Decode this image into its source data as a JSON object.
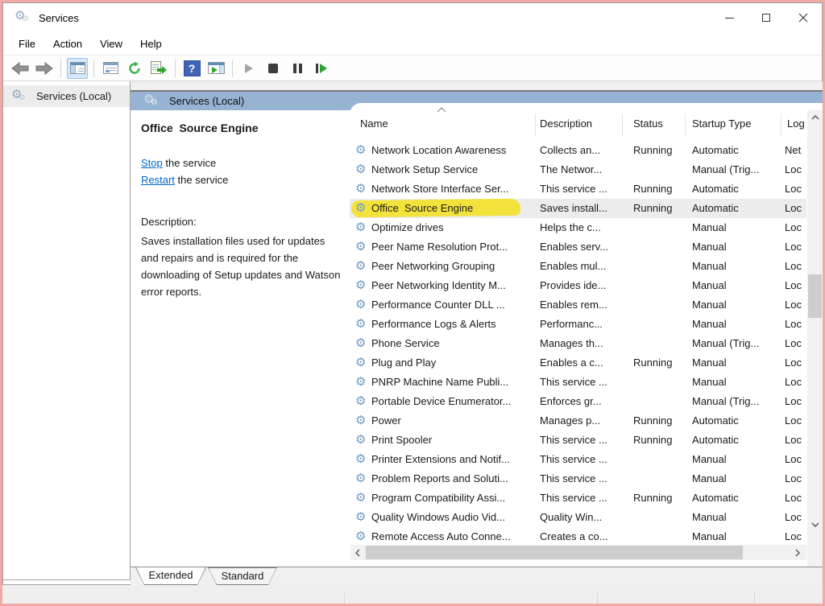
{
  "window": {
    "title": "Services"
  },
  "menu": {
    "items": [
      "File",
      "Action",
      "View",
      "Help"
    ]
  },
  "toolbar": {
    "icons": [
      "back",
      "forward",
      "show-console-tree",
      "properties",
      "refresh",
      "export-list",
      "help",
      "show-action-pane",
      "start-service",
      "stop-service",
      "pause-service",
      "restart-service"
    ]
  },
  "tree": {
    "root_label": "Services (Local)"
  },
  "banner": {
    "title": "Services (Local)"
  },
  "detail": {
    "service_name": "Office  Source Engine",
    "stop_link": "Stop",
    "stop_rest": " the service",
    "restart_link": "Restart",
    "restart_rest": " the service",
    "description_label": "Description:",
    "description": "Saves installation files used for updates and repairs and is required for the downloading of Setup updates and Watson error reports."
  },
  "table": {
    "columns": [
      "Name",
      "Description",
      "Status",
      "Startup Type",
      "Log"
    ],
    "selected_index": 3,
    "rows": [
      {
        "name": "Network Location Awareness",
        "description": "Collects an...",
        "status": "Running",
        "startup": "Automatic",
        "logon": "Net"
      },
      {
        "name": "Network Setup Service",
        "description": "The Networ...",
        "status": "",
        "startup": "Manual (Trig...",
        "logon": "Loc"
      },
      {
        "name": "Network Store Interface Ser...",
        "description": "This service ...",
        "status": "Running",
        "startup": "Automatic",
        "logon": "Loc"
      },
      {
        "name": "Office  Source Engine",
        "description": "Saves install...",
        "status": "Running",
        "startup": "Automatic",
        "logon": "Loc"
      },
      {
        "name": "Optimize drives",
        "description": "Helps the c...",
        "status": "",
        "startup": "Manual",
        "logon": "Loc"
      },
      {
        "name": "Peer Name Resolution Prot...",
        "description": "Enables serv...",
        "status": "",
        "startup": "Manual",
        "logon": "Loc"
      },
      {
        "name": "Peer Networking Grouping",
        "description": "Enables mul...",
        "status": "",
        "startup": "Manual",
        "logon": "Loc"
      },
      {
        "name": "Peer Networking Identity M...",
        "description": "Provides ide...",
        "status": "",
        "startup": "Manual",
        "logon": "Loc"
      },
      {
        "name": "Performance Counter DLL ...",
        "description": "Enables rem...",
        "status": "",
        "startup": "Manual",
        "logon": "Loc"
      },
      {
        "name": "Performance Logs & Alerts",
        "description": "Performanc...",
        "status": "",
        "startup": "Manual",
        "logon": "Loc"
      },
      {
        "name": "Phone Service",
        "description": "Manages th...",
        "status": "",
        "startup": "Manual (Trig...",
        "logon": "Loc"
      },
      {
        "name": "Plug and Play",
        "description": "Enables a c...",
        "status": "Running",
        "startup": "Manual",
        "logon": "Loc"
      },
      {
        "name": "PNRP Machine Name Publi...",
        "description": "This service ...",
        "status": "",
        "startup": "Manual",
        "logon": "Loc"
      },
      {
        "name": "Portable Device Enumerator...",
        "description": "Enforces gr...",
        "status": "",
        "startup": "Manual (Trig...",
        "logon": "Loc"
      },
      {
        "name": "Power",
        "description": "Manages p...",
        "status": "Running",
        "startup": "Automatic",
        "logon": "Loc"
      },
      {
        "name": "Print Spooler",
        "description": "This service ...",
        "status": "Running",
        "startup": "Automatic",
        "logon": "Loc"
      },
      {
        "name": "Printer Extensions and Notif...",
        "description": "This service ...",
        "status": "",
        "startup": "Manual",
        "logon": "Loc"
      },
      {
        "name": "Problem Reports and Soluti...",
        "description": "This service ...",
        "status": "",
        "startup": "Manual",
        "logon": "Loc"
      },
      {
        "name": "Program Compatibility Assi...",
        "description": "This service ...",
        "status": "Running",
        "startup": "Automatic",
        "logon": "Loc"
      },
      {
        "name": "Quality Windows Audio Vid...",
        "description": "Quality Win...",
        "status": "",
        "startup": "Manual",
        "logon": "Loc"
      },
      {
        "name": "Remote Access Auto Conne...",
        "description": "Creates a co...",
        "status": "",
        "startup": "Manual",
        "logon": "Loc"
      }
    ]
  },
  "tabs": {
    "items": [
      "Extended",
      "Standard"
    ],
    "active": "Extended"
  },
  "colors": {
    "screenshot_border": "#f2a9a3",
    "banner_blue": "#97b3d3",
    "highlight_yellow": "#f2e23b",
    "selected_row": "#ececec",
    "link_blue": "#0066cc"
  }
}
